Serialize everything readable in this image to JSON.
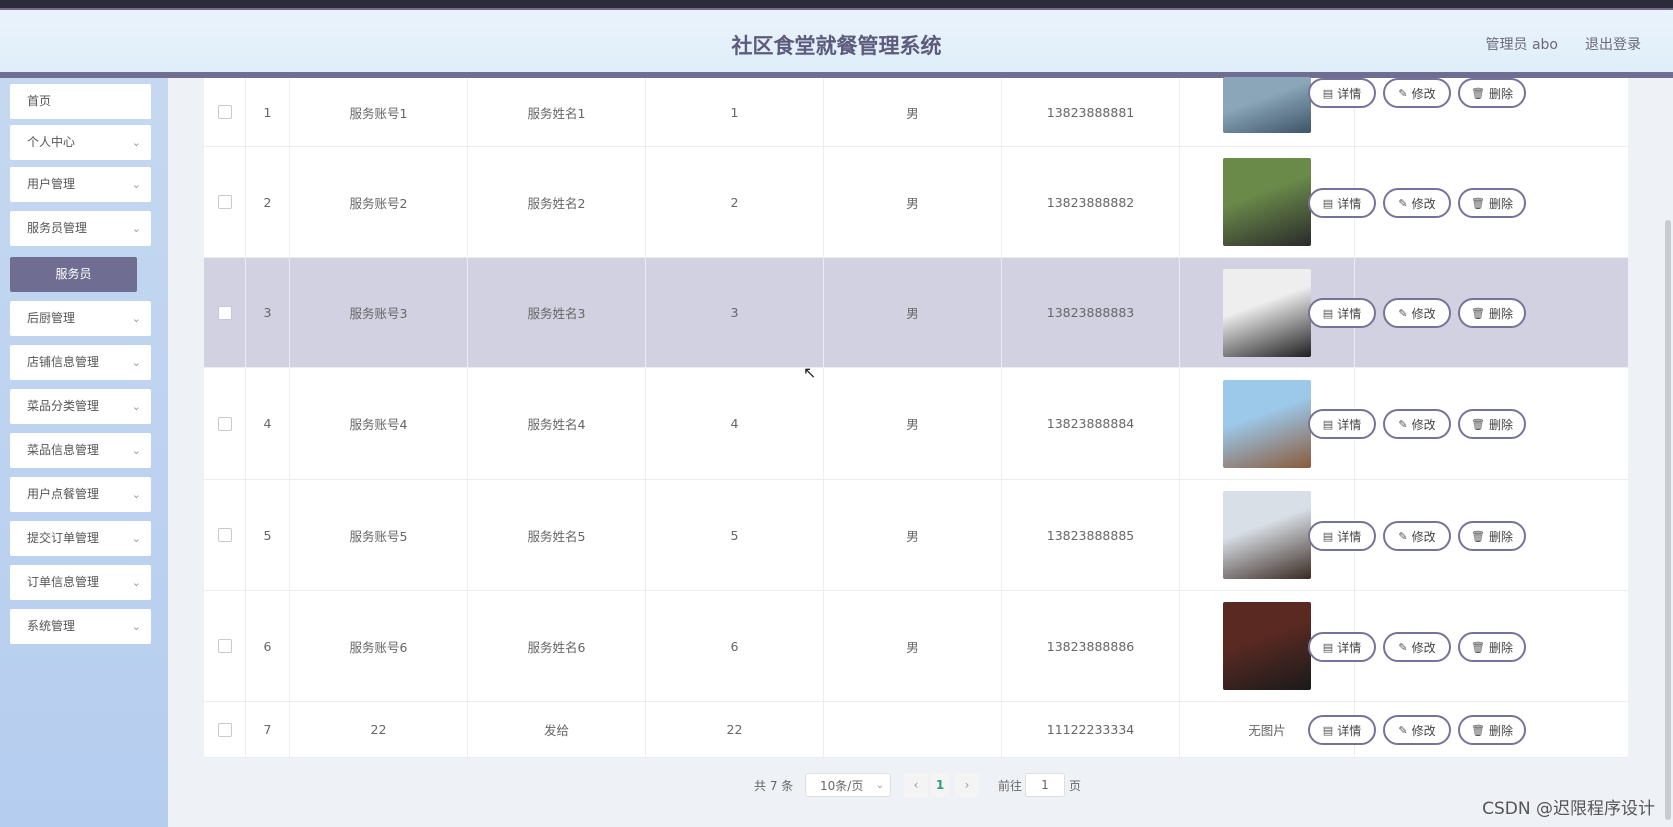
{
  "header": {
    "title": "社区食堂就餐管理系统",
    "admin": "管理员 abo",
    "logout": "退出登录"
  },
  "sidebar": {
    "items": [
      {
        "label": "首页",
        "chevron": ""
      },
      {
        "label": "个人中心",
        "chevron": "⌄"
      },
      {
        "label": "用户管理",
        "chevron": "⌄"
      },
      {
        "label": "服务员管理",
        "chevron": "⌄"
      },
      {
        "label": "后厨管理",
        "chevron": "⌄"
      },
      {
        "label": "店铺信息管理",
        "chevron": "⌄"
      },
      {
        "label": "菜品分类管理",
        "chevron": "⌄"
      },
      {
        "label": "菜品信息管理",
        "chevron": "⌄"
      },
      {
        "label": "用户点餐管理",
        "chevron": "⌄"
      },
      {
        "label": "提交订单管理",
        "chevron": "⌄"
      },
      {
        "label": "订单信息管理",
        "chevron": "⌄"
      },
      {
        "label": "系统管理",
        "chevron": "⌄"
      }
    ],
    "submenu_active": "服务员"
  },
  "table": {
    "rows": [
      {
        "idx": "1",
        "account": "服务账号1",
        "name": "服务姓名1",
        "num": "1",
        "gender": "男",
        "phone": "13823888881",
        "photo": "photo",
        "photo_colors": [
          "#8aa6b8",
          "#3e5468"
        ]
      },
      {
        "idx": "2",
        "account": "服务账号2",
        "name": "服务姓名2",
        "num": "2",
        "gender": "男",
        "phone": "13823888882",
        "photo": "photo",
        "photo_colors": [
          "#6a8a4a",
          "#2a2a2a"
        ]
      },
      {
        "idx": "3",
        "account": "服务账号3",
        "name": "服务姓名3",
        "num": "3",
        "gender": "男",
        "phone": "13823888883",
        "photo": "photo",
        "photo_colors": [
          "#eeeeee",
          "#1e1e1e"
        ]
      },
      {
        "idx": "4",
        "account": "服务账号4",
        "name": "服务姓名4",
        "num": "4",
        "gender": "男",
        "phone": "13823888884",
        "photo": "photo",
        "photo_colors": [
          "#9cc8ea",
          "#8a5a3a"
        ]
      },
      {
        "idx": "5",
        "account": "服务账号5",
        "name": "服务姓名5",
        "num": "5",
        "gender": "男",
        "phone": "13823888885",
        "photo": "photo",
        "photo_colors": [
          "#d8dfe6",
          "#3a2a22"
        ]
      },
      {
        "idx": "6",
        "account": "服务账号6",
        "name": "服务姓名6",
        "num": "6",
        "gender": "男",
        "phone": "13823888886",
        "photo": "photo",
        "photo_colors": [
          "#5a2a22",
          "#1a1a1a"
        ]
      },
      {
        "idx": "7",
        "account": "22",
        "name": "发给",
        "num": "22",
        "gender": "",
        "phone": "11122233334",
        "photo": "无图片",
        "photo_colors": []
      }
    ],
    "actions": {
      "detail": "详情",
      "edit": "修改",
      "delete": "删除"
    },
    "highlighted_row": 3
  },
  "pagination": {
    "total": "共 7 条",
    "page_size": "10条/页",
    "current_page": "1",
    "goto_label": "前往",
    "goto_value": "1",
    "page_unit": "页"
  },
  "watermark": "CSDN @迟限程序设计"
}
